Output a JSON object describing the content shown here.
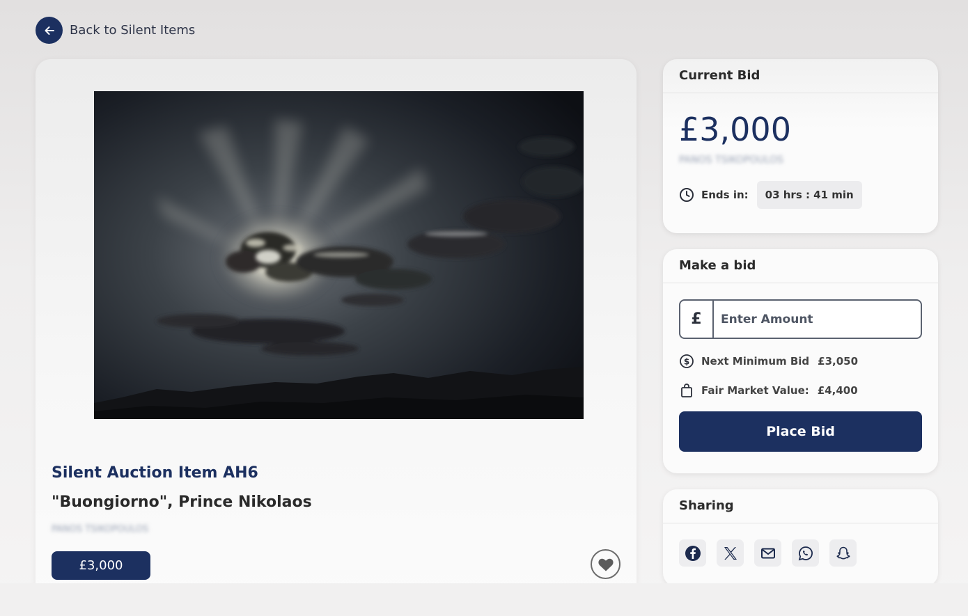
{
  "nav": {
    "back_label": "Back to Silent Items"
  },
  "item": {
    "number": "Silent Auction Item AH6",
    "title": "\"Buongiorno\", Prince Nikolaos",
    "donor": "PANOS TSIKOPOULOS",
    "price": "£3,000",
    "artwork_alt": "Sunlight breaking through clouds over a dark mountain ridge"
  },
  "current_bid": {
    "header": "Current Bid",
    "amount": "£3,000",
    "bidder": "PANOS TSIKOPOULOS",
    "ends_label": "Ends in:",
    "ends_value": "03 hrs : 41 min"
  },
  "make_bid": {
    "header": "Make a bid",
    "currency": "£",
    "placeholder": "Enter Amount",
    "next_min_label": "Next Minimum Bid",
    "next_min_value": "£3,050",
    "fair_value_label": "Fair Market Value:",
    "fair_value_value": "£4,400",
    "button_label": "Place Bid"
  },
  "sharing": {
    "header": "Sharing",
    "icons": [
      "facebook-icon",
      "x-icon",
      "mail-icon",
      "whatsapp-icon",
      "snapchat-icon"
    ]
  },
  "colors": {
    "brand": "#1c3060"
  }
}
